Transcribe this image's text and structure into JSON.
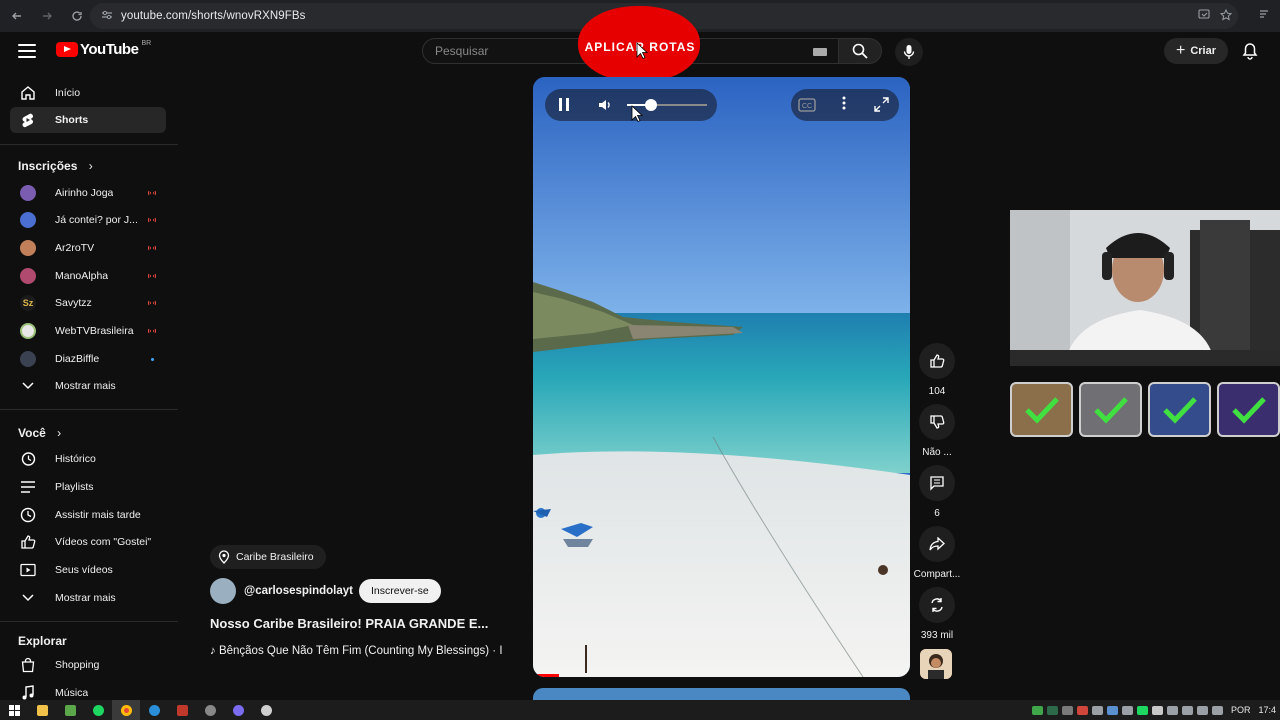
{
  "browser": {
    "url": "youtube.com/shorts/wnovRXN9FBs"
  },
  "header": {
    "logo_text": "YouTube",
    "region": "BR",
    "search_placeholder": "Pesquisar",
    "create_label": "Criar"
  },
  "overlay": {
    "aplicar_rotas": "APLICAR ROTAS"
  },
  "sidebar": {
    "main": [
      {
        "label": "Início",
        "icon": "home-icon"
      },
      {
        "label": "Shorts",
        "icon": "shorts-icon"
      }
    ],
    "subscriptions_title": "Inscrições",
    "subscriptions": [
      {
        "label": "Airinho Joga",
        "live": true
      },
      {
        "label": "Já contei? por J...",
        "live": true
      },
      {
        "label": "Ar2roTV",
        "live": true
      },
      {
        "label": "ManoAlpha",
        "live": true
      },
      {
        "label": "Savytzz",
        "live": true
      },
      {
        "label": "WebTVBrasileira",
        "live": true
      },
      {
        "label": "DiazBiffle",
        "live": false
      }
    ],
    "show_more": "Mostrar mais",
    "you_title": "Você",
    "you_items": [
      {
        "label": "Histórico",
        "icon": "history-icon"
      },
      {
        "label": "Playlists",
        "icon": "playlists-icon"
      },
      {
        "label": "Assistir mais tarde",
        "icon": "watch-later-icon"
      },
      {
        "label": "Vídeos com \"Gostei\"",
        "icon": "thumbs-up-icon"
      },
      {
        "label": "Seus vídeos",
        "icon": "your-videos-icon"
      }
    ],
    "show_more_2": "Mostrar mais",
    "explore_title": "Explorar",
    "explore_items": [
      {
        "label": "Shopping",
        "icon": "shopping-bag-icon"
      },
      {
        "label": "Música",
        "icon": "music-note-icon"
      }
    ]
  },
  "player": {
    "volume_level": 0.3,
    "progress": 0.07
  },
  "actions": {
    "likes": "104",
    "dislike": "Não ...",
    "comments": "6",
    "share": "Compart...",
    "remix": "393 mil"
  },
  "short_info": {
    "location": "Caribe Brasileiro",
    "channel": "@carlosespindolayt",
    "subscribe": "Inscrever-se",
    "title": "Nosso Caribe Brasileiro! PRAIA GRANDE E...",
    "music": "Bênçãos Que Não Têm Fim (Counting My Blessings) · I"
  },
  "taskbar": {
    "lang": "POR",
    "time": "17:4"
  },
  "colors": {
    "accent_red": "#ff0000",
    "overlay_red": "#e60000"
  }
}
